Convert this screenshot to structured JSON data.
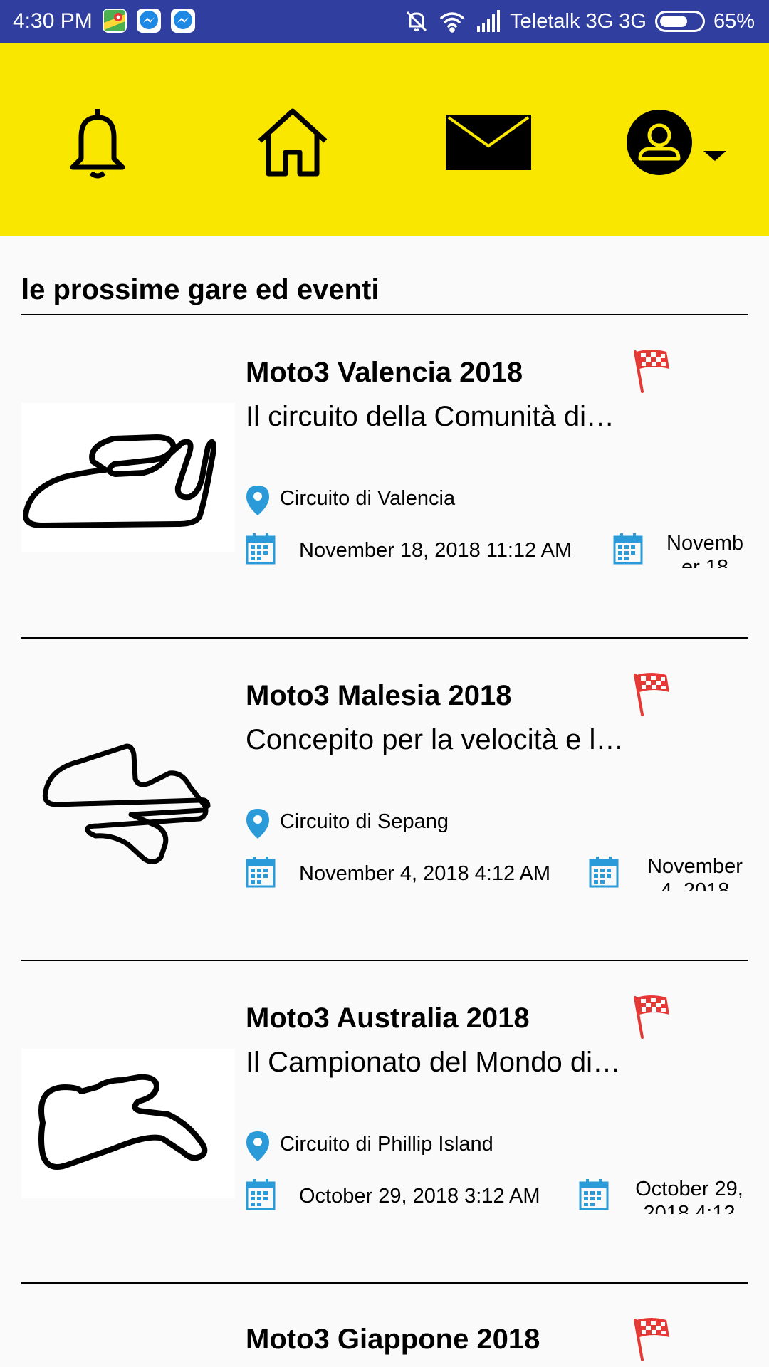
{
  "status_bar": {
    "time": "4:30 PM",
    "carrier": "Teletalk 3G 3G",
    "battery": "65%",
    "battery_level": 0.65,
    "icons": [
      "maps-icon",
      "messenger-icon",
      "messenger-icon",
      "mute-icon",
      "wifi-icon",
      "signal-icon",
      "battery-icon"
    ]
  },
  "nav": {
    "items": [
      "bell-icon",
      "home-icon",
      "mail-icon",
      "profile-icon"
    ],
    "background": "#fae700"
  },
  "section_title": "le prossime gare ed eventi",
  "colors": {
    "accent_blue": "#2a9ad8",
    "flag_red": "#e53935",
    "status_bar": "#303f9f",
    "nav_yellow": "#fae700"
  },
  "events": [
    {
      "title": "Moto3 Valencia 2018",
      "description": "Il circuito della Comunità di…",
      "location": "Circuito di Valencia",
      "start_date": "November 18, 2018 11:12 AM",
      "end_date": "November 18"
    },
    {
      "title": "Moto3 Malesia 2018",
      "description": "Concepito per la velocità e l…",
      "location": "Circuito di Sepang",
      "start_date": "November 4, 2018 4:12 AM",
      "end_date": "November 4, 2018"
    },
    {
      "title": "Moto3 Australia 2018",
      "description": "Il Campionato del Mondo di…",
      "location": "Circuito di Phillip Island",
      "start_date": "October 29, 2018 3:12 AM",
      "end_date": "October 29, 2018 4:12"
    },
    {
      "title": "Moto3 Giappone 2018"
    }
  ]
}
